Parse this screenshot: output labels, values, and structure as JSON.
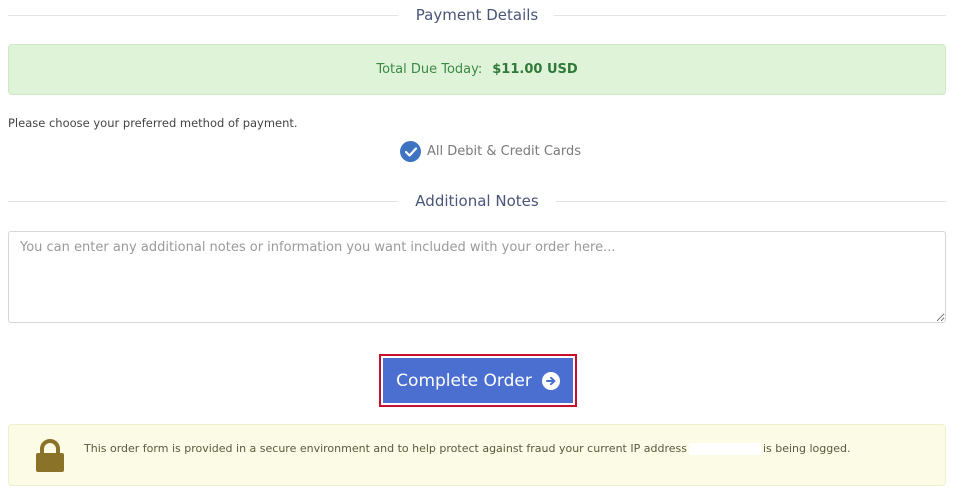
{
  "payment_header": {
    "title": "Payment Details"
  },
  "total": {
    "label": "Total Due Today:",
    "amount": "$11.00 USD"
  },
  "payment_methods": {
    "prompt": "Please choose your preferred method of payment.",
    "selected": "All Debit & Credit Cards"
  },
  "notes_header": {
    "title": "Additional Notes"
  },
  "notes": {
    "value": "",
    "placeholder": "You can enter any additional notes or information you want included with your order here..."
  },
  "order_button": {
    "label": "Complete Order"
  },
  "security_notice": {
    "text_before": "This order form is provided in a secure environment and to help protect against fraud your current IP address",
    "text_after": "is being logged."
  },
  "colors": {
    "accent_blue": "#4a6fd0",
    "success_green": "#dff3d9",
    "highlight_red": "#c8102e",
    "notice_yellow": "#fbfbe6",
    "lock_gold": "#8a7328"
  },
  "icons": {
    "check": "check-circle-icon",
    "arrow": "arrow-circle-right-icon",
    "lock": "lock-icon"
  }
}
